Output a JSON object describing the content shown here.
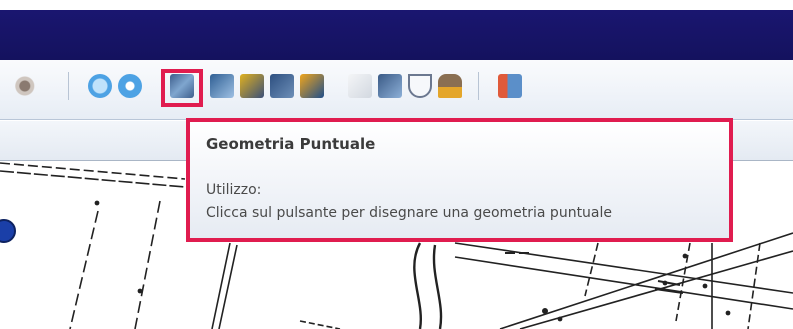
{
  "tooltip": {
    "title": "Geometria Puntuale",
    "usage_label": "Utilizzo:",
    "description": "Clicca sul pulsante per disegnare una geometria puntuale"
  },
  "toolbar": {
    "buttons": [
      {
        "icon": "pan-hand-icon"
      },
      {
        "icon": "play-icon"
      },
      {
        "icon": "stop-icon"
      },
      {
        "icon": "point-geometry-icon",
        "highlighted": true
      },
      {
        "icon": "line-geometry-icon"
      },
      {
        "icon": "edit-geometry-icon"
      },
      {
        "icon": "select-geometry-icon"
      },
      {
        "icon": "paint-icon"
      },
      {
        "icon": "copy-icon"
      },
      {
        "icon": "edit-note-icon"
      },
      {
        "icon": "compass-icon"
      },
      {
        "icon": "stamp-icon"
      },
      {
        "icon": "exit-icon"
      }
    ]
  },
  "colors": {
    "title_bar": "#14125e",
    "highlight": "#e01c4f"
  }
}
